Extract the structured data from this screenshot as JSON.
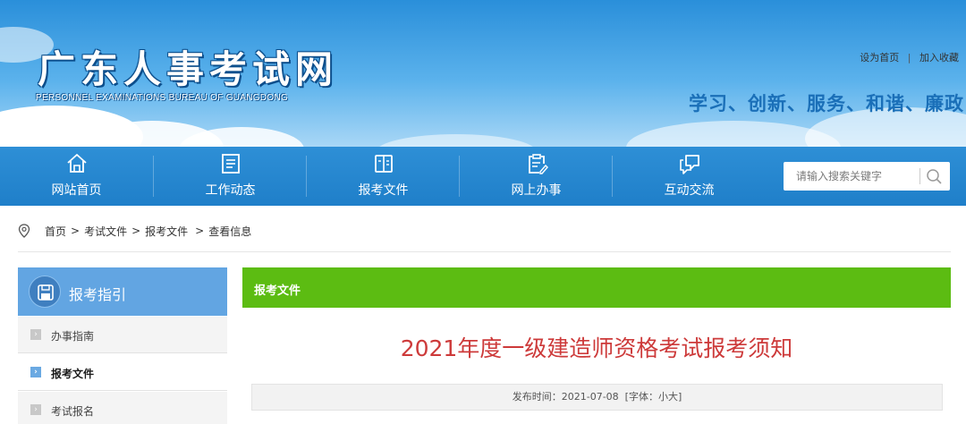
{
  "header": {
    "logo_title": "广东人事考试网",
    "logo_subtitle": "PERSONNEL EXAMINATIONS BUREAU OF GUANGDONG",
    "top_links": [
      "设为首页",
      "加入收藏"
    ],
    "top_link_separator": "|",
    "slogan": "学习、创新、服务、和谐、廉政"
  },
  "nav": {
    "items": [
      {
        "label": "网站首页",
        "icon": "home-icon"
      },
      {
        "label": "工作动态",
        "icon": "news-icon"
      },
      {
        "label": "报考文件",
        "icon": "book-icon"
      },
      {
        "label": "网上办事",
        "icon": "clipboard-edit-icon"
      },
      {
        "label": "互动交流",
        "icon": "chat-bubble-icon"
      }
    ],
    "search": {
      "placeholder": "请输入搜索关键字",
      "icon": "search-icon"
    }
  },
  "breadcrumb": {
    "icon": "location-pin-icon",
    "items": [
      "首页",
      "考试文件",
      "报考文件",
      "查看信息"
    ],
    "separator": ">"
  },
  "sidebar": {
    "title": "报考指引",
    "title_icon": "save-disk-icon",
    "items": [
      {
        "label": "办事指南",
        "active": false
      },
      {
        "label": "报考文件",
        "active": true
      },
      {
        "label": "考试报名",
        "active": false
      }
    ],
    "item_marker": "›"
  },
  "main": {
    "section_title": "报考文件",
    "article_title": "2021年度一级建造师资格考试报考须知",
    "meta": {
      "publish_label": "发布时间：",
      "publish_date": "2021-07-08",
      "font_open": "[字体：",
      "font_small": "小",
      "font_large": "大",
      "font_close": "]"
    }
  },
  "colors": {
    "nav_blue": "#2184cf",
    "side_head_blue": "#62a5e2",
    "section_green": "#5cbc12",
    "title_red": "#cd3a3a",
    "slogan_blue": "#1a6fb8"
  }
}
